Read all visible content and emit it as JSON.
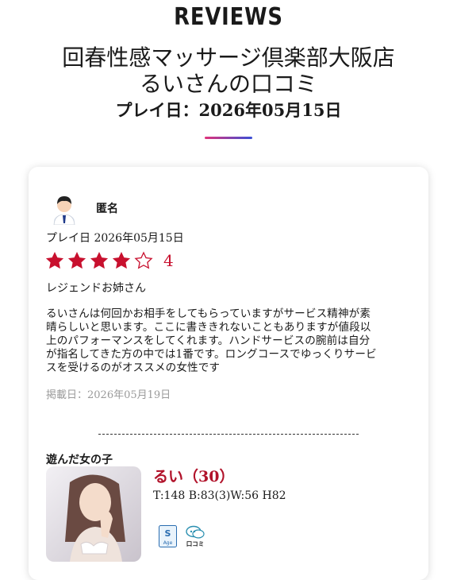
{
  "header": {
    "brand": "REVIEWS",
    "shop_line1": "回春性感マッサージ倶楽部大阪店",
    "shop_line2": "るいさんの口コミ",
    "play_date": "プレイ日：2026年05月15日"
  },
  "review": {
    "reviewer_name": "匿名",
    "play_date_label": "プレイ日",
    "play_date_value": "2026年05月15日",
    "rating": 4,
    "rating_max": 5,
    "rating_text": "4",
    "title": "レジェンドお姉さん",
    "body_lines": [
      "るいさんは何回かお相手をしてもらっていますがサービス精神が素",
      "晴らしいと思います。ここに書ききれないこともありますが値段以",
      "上のパフォーマンスをしてくれます。ハンドサービスの腕前は自分",
      "が指名してきた方の中では1番です。ロングコースでゆっくりサービ",
      "スを受けるのがオススメの女性です"
    ],
    "posted_date": "掲載日：2026年05月19日"
  },
  "girl": {
    "section_title": "遊んだ女の子",
    "name": "るい（30）",
    "stats": "T:148 B:83(3)W:56 H82",
    "badge_s_text": "S",
    "badge_s_sub": "Age",
    "badge_review_text": "口コミ"
  },
  "colors": {
    "star": "#c8102e",
    "accent_pink": "#e0337a",
    "accent_blue": "#3a4fd6",
    "name_red": "#b1122a",
    "muted": "#9a9a9a"
  },
  "icons": {
    "avatar": "reviewer-avatar-icon",
    "star_filled": "star-filled-icon",
    "star_empty": "star-empty-icon",
    "badge_s": "s-age-badge-icon",
    "badge_review": "review-bubble-icon"
  }
}
